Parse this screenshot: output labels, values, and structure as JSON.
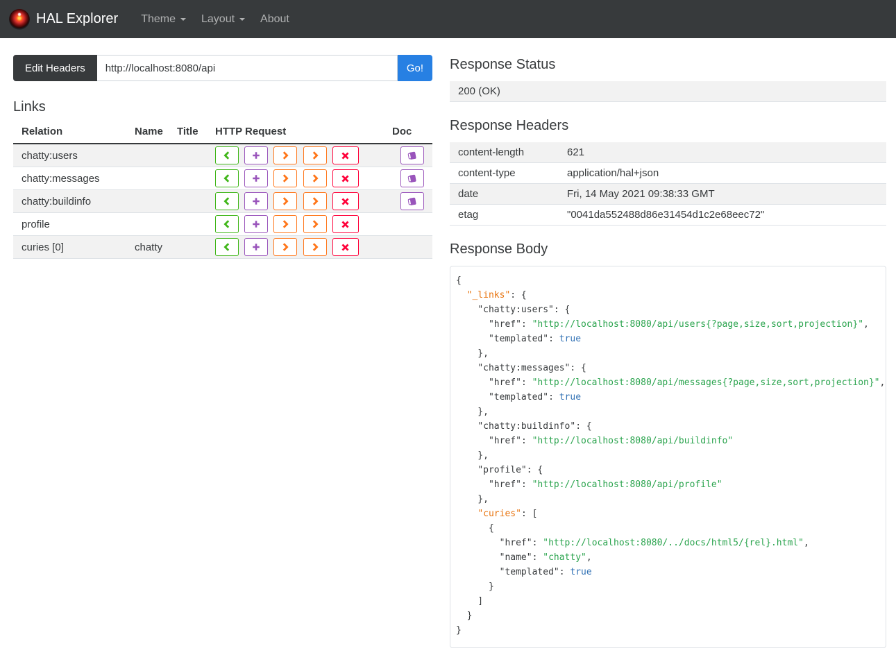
{
  "navbar": {
    "brand": "HAL Explorer",
    "items": [
      {
        "label": "Theme",
        "dropdown": true
      },
      {
        "label": "Layout",
        "dropdown": true
      },
      {
        "label": "About",
        "dropdown": false
      }
    ]
  },
  "address_bar": {
    "edit_headers_label": "Edit Headers",
    "url_value": "http://localhost:8080/api",
    "go_label": "Go!"
  },
  "links_section": {
    "title": "Links",
    "columns": [
      "Relation",
      "Name",
      "Title",
      "HTTP Request",
      "Doc"
    ],
    "http_button_icons": [
      {
        "name": "get-request-button",
        "icon": "chevron-left-icon",
        "color": "#3fb618"
      },
      {
        "name": "post-request-button",
        "icon": "plus-icon",
        "color": "#9954bb"
      },
      {
        "name": "put-request-button",
        "icon": "chevron-right-icon",
        "color": "#ff7518"
      },
      {
        "name": "patch-request-button",
        "icon": "chevron-right-icon",
        "color": "#ff7518"
      },
      {
        "name": "delete-request-button",
        "icon": "x-icon",
        "color": "#ff0039"
      },
      {
        "name": "doc-button",
        "icon": "book-icon",
        "color": "#9954bb"
      }
    ],
    "rows": [
      {
        "relation": "chatty:users",
        "name": "",
        "title": "",
        "doc": true
      },
      {
        "relation": "chatty:messages",
        "name": "",
        "title": "",
        "doc": true
      },
      {
        "relation": "chatty:buildinfo",
        "name": "",
        "title": "",
        "doc": true
      },
      {
        "relation": "profile",
        "name": "",
        "title": "",
        "doc": false
      },
      {
        "relation": "curies [0]",
        "name": "chatty",
        "title": "",
        "doc": false
      }
    ]
  },
  "response_status": {
    "title": "Response Status",
    "value": "200 (OK)"
  },
  "response_headers": {
    "title": "Response Headers",
    "rows": [
      [
        "content-length",
        "621"
      ],
      [
        "content-type",
        "application/hal+json"
      ],
      [
        "date",
        "Fri, 14 May 2021 09:38:33 GMT"
      ],
      [
        "etag",
        "\"0041da552488d86e31454d1c2e68eec72\""
      ]
    ]
  },
  "response_body": {
    "title": "Response Body",
    "syntax_colors": {
      "reserved_key": "#e8740f",
      "key": "#373a3c",
      "string": "#2ba44e",
      "boolean": "#3272b5"
    },
    "lines": [
      [
        {
          "c": "pln",
          "t": "{"
        }
      ],
      [
        {
          "c": "pln",
          "t": "  "
        },
        {
          "c": "okey",
          "t": "\"_links\""
        },
        {
          "c": "pln",
          "t": ": {"
        }
      ],
      [
        {
          "c": "pln",
          "t": "    "
        },
        {
          "c": "key",
          "t": "\"chatty:users\""
        },
        {
          "c": "pln",
          "t": ": {"
        }
      ],
      [
        {
          "c": "pln",
          "t": "      "
        },
        {
          "c": "key",
          "t": "\"href\""
        },
        {
          "c": "pln",
          "t": ": "
        },
        {
          "c": "str",
          "t": "\"http://localhost:8080/api/users{?page,size,sort,projection}\""
        },
        {
          "c": "pln",
          "t": ","
        }
      ],
      [
        {
          "c": "pln",
          "t": "      "
        },
        {
          "c": "key",
          "t": "\"templated\""
        },
        {
          "c": "pln",
          "t": ": "
        },
        {
          "c": "bool",
          "t": "true"
        }
      ],
      [
        {
          "c": "pln",
          "t": "    },"
        }
      ],
      [
        {
          "c": "pln",
          "t": "    "
        },
        {
          "c": "key",
          "t": "\"chatty:messages\""
        },
        {
          "c": "pln",
          "t": ": {"
        }
      ],
      [
        {
          "c": "pln",
          "t": "      "
        },
        {
          "c": "key",
          "t": "\"href\""
        },
        {
          "c": "pln",
          "t": ": "
        },
        {
          "c": "str",
          "t": "\"http://localhost:8080/api/messages{?page,size,sort,projection}\""
        },
        {
          "c": "pln",
          "t": ","
        }
      ],
      [
        {
          "c": "pln",
          "t": "      "
        },
        {
          "c": "key",
          "t": "\"templated\""
        },
        {
          "c": "pln",
          "t": ": "
        },
        {
          "c": "bool",
          "t": "true"
        }
      ],
      [
        {
          "c": "pln",
          "t": "    },"
        }
      ],
      [
        {
          "c": "pln",
          "t": "    "
        },
        {
          "c": "key",
          "t": "\"chatty:buildinfo\""
        },
        {
          "c": "pln",
          "t": ": {"
        }
      ],
      [
        {
          "c": "pln",
          "t": "      "
        },
        {
          "c": "key",
          "t": "\"href\""
        },
        {
          "c": "pln",
          "t": ": "
        },
        {
          "c": "str",
          "t": "\"http://localhost:8080/api/buildinfo\""
        }
      ],
      [
        {
          "c": "pln",
          "t": "    },"
        }
      ],
      [
        {
          "c": "pln",
          "t": "    "
        },
        {
          "c": "key",
          "t": "\"profile\""
        },
        {
          "c": "pln",
          "t": ": {"
        }
      ],
      [
        {
          "c": "pln",
          "t": "      "
        },
        {
          "c": "key",
          "t": "\"href\""
        },
        {
          "c": "pln",
          "t": ": "
        },
        {
          "c": "str",
          "t": "\"http://localhost:8080/api/profile\""
        }
      ],
      [
        {
          "c": "pln",
          "t": "    },"
        }
      ],
      [
        {
          "c": "pln",
          "t": "    "
        },
        {
          "c": "okey",
          "t": "\"curies\""
        },
        {
          "c": "pln",
          "t": ": ["
        }
      ],
      [
        {
          "c": "pln",
          "t": "      {"
        }
      ],
      [
        {
          "c": "pln",
          "t": "        "
        },
        {
          "c": "key",
          "t": "\"href\""
        },
        {
          "c": "pln",
          "t": ": "
        },
        {
          "c": "str",
          "t": "\"http://localhost:8080/../docs/html5/{rel}.html\""
        },
        {
          "c": "pln",
          "t": ","
        }
      ],
      [
        {
          "c": "pln",
          "t": "        "
        },
        {
          "c": "key",
          "t": "\"name\""
        },
        {
          "c": "pln",
          "t": ": "
        },
        {
          "c": "str",
          "t": "\"chatty\""
        },
        {
          "c": "pln",
          "t": ","
        }
      ],
      [
        {
          "c": "pln",
          "t": "        "
        },
        {
          "c": "key",
          "t": "\"templated\""
        },
        {
          "c": "pln",
          "t": ": "
        },
        {
          "c": "bool",
          "t": "true"
        }
      ],
      [
        {
          "c": "pln",
          "t": "      }"
        }
      ],
      [
        {
          "c": "pln",
          "t": "    ]"
        }
      ],
      [
        {
          "c": "pln",
          "t": "  }"
        }
      ],
      [
        {
          "c": "pln",
          "t": "}"
        }
      ]
    ]
  }
}
